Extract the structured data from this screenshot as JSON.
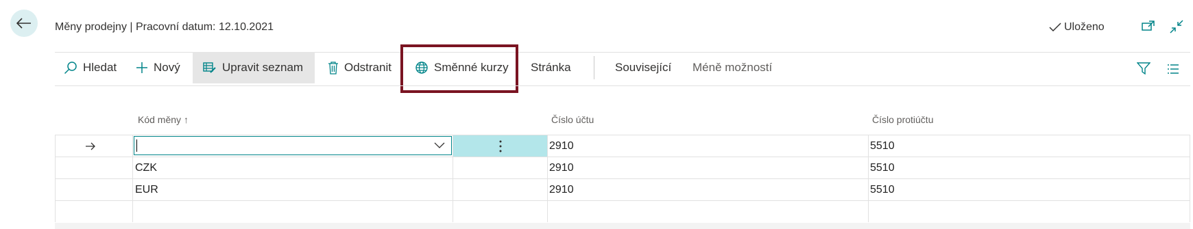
{
  "page": {
    "title": "Měny prodejny | Pracovní datum: 12.10.2021",
    "saved_label": "Uloženo"
  },
  "toolbar": {
    "search": "Hledat",
    "new": "Nový",
    "edit_list": "Upravit seznam",
    "delete": "Odstranit",
    "exchange_rates": "Směnné kurzy",
    "page": "Stránka",
    "related": "Související",
    "fewer_options": "Méně možností"
  },
  "columns": {
    "code": "Kód měny",
    "sort_indicator": "↑",
    "account": "Číslo účtu",
    "contra_account": "Číslo protiúčtu"
  },
  "rows": [
    {
      "code": "",
      "account": "2910",
      "contra": "5510"
    },
    {
      "code": "CZK",
      "account": "2910",
      "contra": "5510"
    },
    {
      "code": "EUR",
      "account": "2910",
      "contra": "5510"
    },
    {
      "code": "",
      "account": "",
      "contra": ""
    }
  ],
  "colors": {
    "accent": "#008489",
    "highlight_border": "#7a1422",
    "selected_cell": "#b3e6ea"
  }
}
